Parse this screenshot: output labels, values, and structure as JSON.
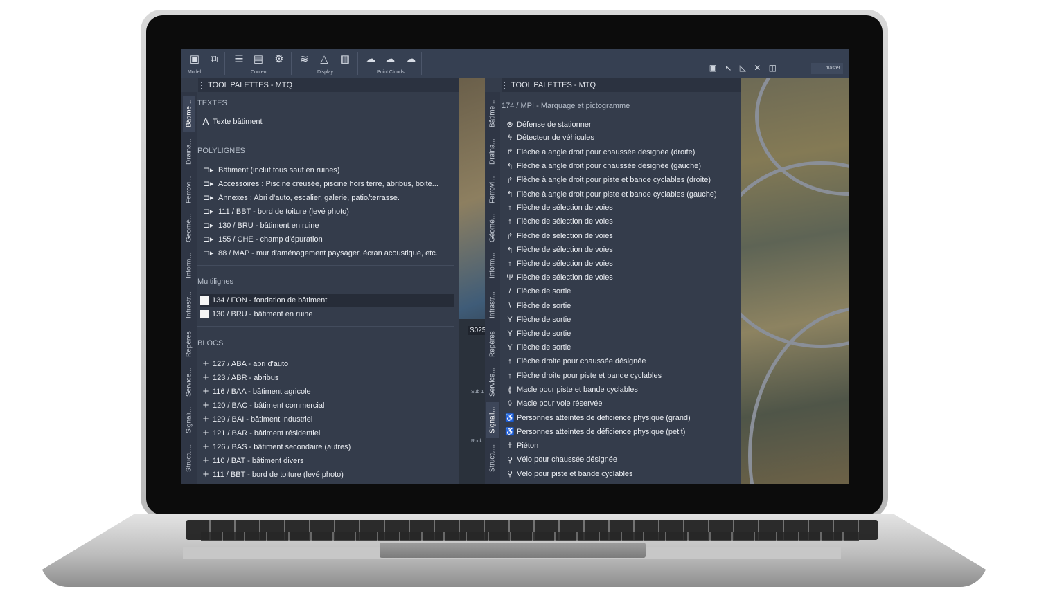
{
  "ribbon": {
    "groups": [
      "Model",
      "Content",
      "Display",
      "Point Clouds"
    ],
    "right_tools": "▣ ↖ ◺ ✕ ◫",
    "workspace": "master"
  },
  "viewport": {
    "label": "S025",
    "small_labels": [
      "Sub 1",
      "Rock"
    ]
  },
  "left_palette": {
    "title": "TOOL PALETTES - MTQ",
    "tabs": [
      "Bâtime...",
      "Draina...",
      "Ferrovi...",
      "Géomé...",
      "Inform...",
      "Infrastr...",
      "Repères",
      "Service...",
      "Signali...",
      "Structu..."
    ],
    "sections": {
      "textes": {
        "header": "TEXTES",
        "items": [
          "Texte bâtiment"
        ]
      },
      "polylignes": {
        "header": "POLYLIGNES",
        "items": [
          "Bâtiment (inclut tous sauf en ruines)",
          "Accessoires : Piscine creusée, piscine hors terre, abribus, boite...",
          "Annexes : Abri d'auto, escalier, galerie, patio/terrasse.",
          "111 / BBT - bord de toiture (levé photo)",
          "130 / BRU - bâtiment en ruine",
          "155 / CHE - champ d'épuration",
          "88 / MAP - mur d'aménagement paysager, écran acoustique, etc."
        ]
      },
      "multilignes": {
        "header": "Multilignes",
        "items": [
          "134 / FON - fondation de bâtiment",
          "130 / BRU - bâtiment en ruine"
        ]
      },
      "blocs": {
        "header": "BLOCS",
        "items": [
          "127 / ABA - abri d'auto",
          "123 / ABR - abribus",
          "116 / BAA - bâtiment agricole",
          "120 / BAC - bâtiment commercial",
          "129 / BAI - bâtiment industriel",
          "121 / BAR - bâtiment résidentiel",
          "126 / BAS - bâtiment secondaire (autres)",
          "110 / BAT - bâtiment divers",
          "111 / BBT - bord de toiture (levé photo)"
        ]
      }
    }
  },
  "right_palette": {
    "title": "TOOL PALETTES - MTQ",
    "tabs": [
      "Bâtime...",
      "Draina...",
      "Ferrovi...",
      "Géomé...",
      "Inform...",
      "Infrastr...",
      "Repères",
      "Service...",
      "Signali...",
      "Structu..."
    ],
    "header": "174 / MPI - Marquage et pictogramme",
    "items": [
      "Défense de stationner",
      "Détecteur de véhicules",
      "Flèche à angle droit pour chaussée désignée (droite)",
      "Flèche à angle droit pour chaussée désignée (gauche)",
      "Flèche à angle droit pour piste et bande cyclables (droite)",
      "Flèche à angle droit pour piste et bande cyclables (gauche)",
      "Flèche de sélection de voies",
      "Flèche de sélection de voies",
      "Flèche de sélection de voies",
      "Flèche de sélection de voies",
      "Flèche de sélection de voies",
      "Flèche de sélection de voies",
      "Flèche de sortie",
      "Flèche de sortie",
      "Flèche de sortie",
      "Flèche de sortie",
      "Flèche de sortie",
      "Flèche droite pour chaussée désignée",
      "Flèche droite pour piste et bande cyclables",
      "Macle pour piste et bande cyclables",
      "Macle pour voie réservée",
      "Personnes atteintes de déficience physique (grand)",
      "Personnes atteintes de déficience physique (petit)",
      "Piéton",
      "Vélo pour chaussée désignée",
      "Vélo pour piste et bande cyclables"
    ],
    "icons": [
      "⊗",
      "ϟ",
      "↱",
      "↰",
      "↱",
      "↰",
      "↑",
      "↑",
      "↱",
      "↰",
      "↑",
      "Ψ",
      "/",
      "\\",
      "Y",
      "Y",
      "Y",
      "↑",
      "↑",
      "≬",
      "◊",
      "♿",
      "♿",
      "ǂ",
      "⚲",
      "⚲"
    ]
  }
}
